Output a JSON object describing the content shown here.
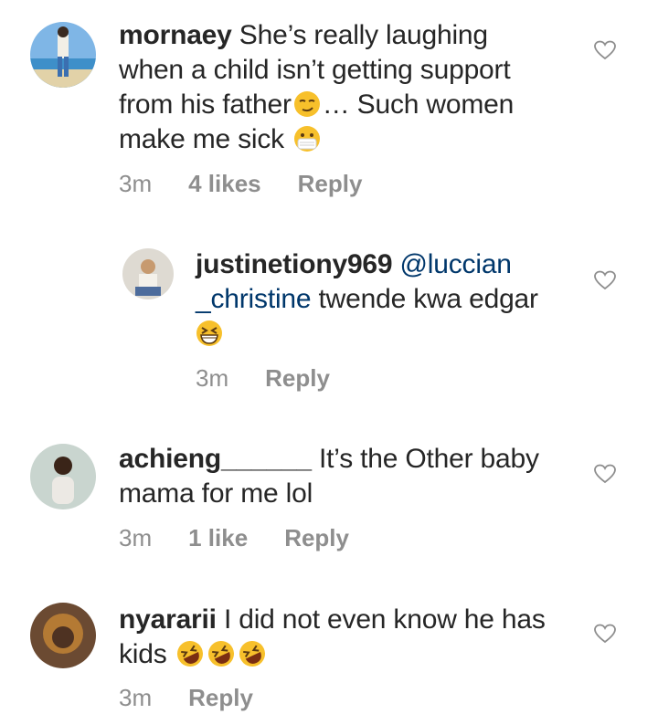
{
  "comments": [
    {
      "username": "mornaey",
      "text_line1": "She’s really laughing",
      "text_line2": "when a child isn’t getting support",
      "text_line3a": "from his father",
      "text_line3b": "… Such women",
      "text_line4": "make me sick",
      "time": "3m",
      "likes": "4 likes",
      "reply": "Reply"
    },
    {
      "username": "justinetiony969",
      "mention_a": "@luccian",
      "mention_b": "_christine",
      "text_rest": " twende kwa edgar",
      "time": "3m",
      "reply": "Reply"
    },
    {
      "username": "achieng______",
      "text_line1": "It’s the Other baby",
      "text_line2": "mama for me lol",
      "time": "3m",
      "likes": "1 like",
      "reply": "Reply"
    },
    {
      "username": "nyararii",
      "text_line1": "I did not even know he has",
      "text_line2": "kids",
      "time": "3m",
      "reply": "Reply"
    }
  ],
  "icons": {
    "heart": "heart-outline-icon",
    "smirk": "smirking-face-emoji",
    "mask": "face-with-medical-mask-emoji",
    "grin": "grinning-squinting-face-emoji",
    "rofl": "rolling-on-floor-laughing-emoji"
  },
  "colors": {
    "text": "#262626",
    "meta": "#8e8e8e",
    "mention": "#00376b",
    "emoji": "#f7c02b"
  }
}
